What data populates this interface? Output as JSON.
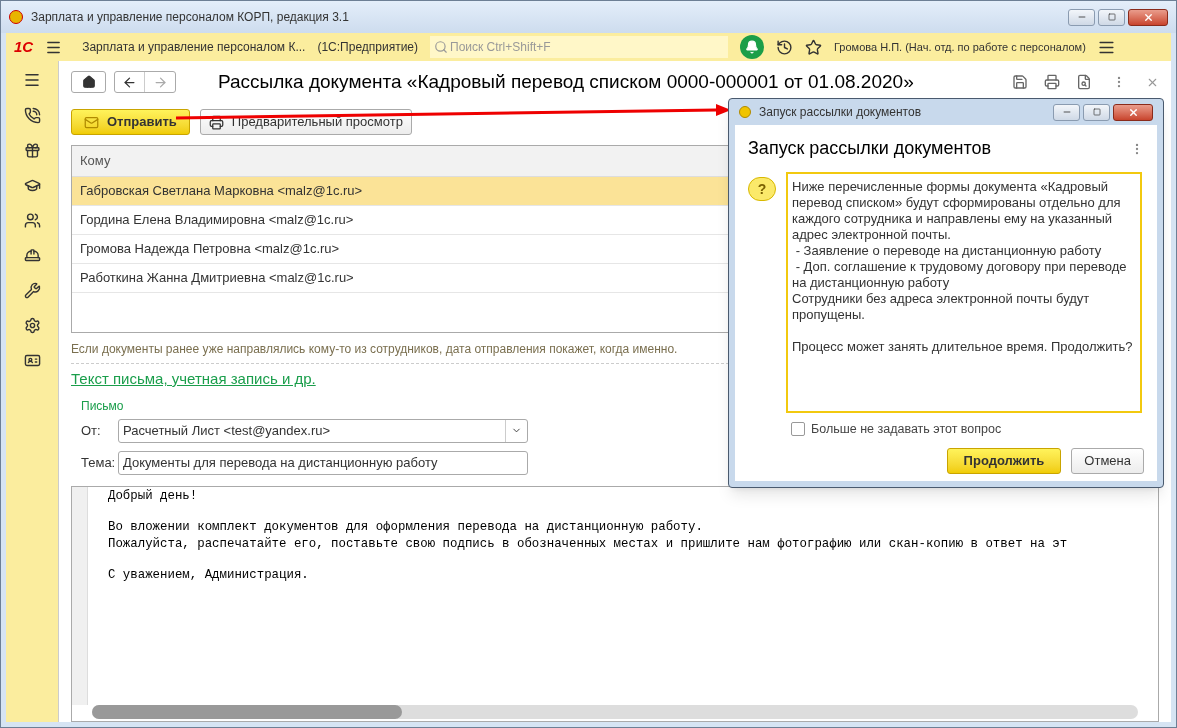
{
  "window": {
    "title": "Зарплата и управление персоналом КОРП, редакция 3.1"
  },
  "app_bar": {
    "logo": "1С",
    "app_name": "Зарплата и управление персоналом К...",
    "platform": "(1С:Предприятие)",
    "search": {
      "placeholder": "Поиск Ctrl+Shift+F"
    },
    "user": "Громова Н.П. (Нач. отд. по работе с персоналом)"
  },
  "form": {
    "title": "Рассылка документа «Кадровый перевод списком 0000-000001 от 01.08.2020»",
    "buttons": [
      {
        "kind": "primary",
        "label": "Отправить"
      },
      {
        "kind": "print",
        "label": "Предварительный просмотр"
      }
    ],
    "table": {
      "columns": [
        "Кому"
      ],
      "rows": [
        {
          "recipient": "Габровская Светлана Марковна <malz@1c.ru>",
          "selected": true
        },
        {
          "recipient": "Гордина Елена Владимировна <malz@1c.ru>",
          "selected": false
        },
        {
          "recipient": "Громова Надежда Петровна <malz@1c.ru>",
          "selected": false
        },
        {
          "recipient": "Работкина Жанна Дмитриевна <malz@1c.ru>",
          "selected": false
        }
      ]
    },
    "hint": "Если документы ранее уже направлялись кому-то из сотрудников, дата отправления покажет, когда именно.",
    "section_link": "Текст письма, учетная запись и др.",
    "group_title": "Письмо",
    "from": {
      "label": "От:",
      "value": "Расчетный Лист <test@yandex.ru>"
    },
    "subject": {
      "label": "Тема:",
      "value": "Документы для перевода на дистанционную работу"
    },
    "body": [
      {
        "lines": [
          "Добрый день!"
        ]
      },
      {
        "lines": [
          "Во вложении комплект документов для оформления перевода на дистанционную работу.",
          "Пожалуйста, распечатайте его, поставьте свою подпись в обозначенных местах и пришлите нам фотографию или скан-копию в ответ на эт"
        ]
      },
      {
        "lines": [
          "С уважением, Администрация."
        ]
      }
    ]
  },
  "dialog": {
    "window_title": "Запуск рассылки документов",
    "icon": "?",
    "heading": "Запуск рассылки документов",
    "message": [
      {
        "lines": [
          "Ниже перечисленные формы документа «Кадровый перевод списком» будут сформированы отдельно для каждого сотрудника и направлены ему на указанный адрес электронной почты.",
          " - Заявление о переводе на дистанционную работу",
          " - Доп. соглашение к трудовому договору при переводе на дистанционную работу",
          "Сотрудники без адреса электронной почты будут пропущены."
        ]
      },
      {
        "lines": [
          "Процесс может занять длительное время. Продолжить?"
        ]
      }
    ],
    "checkbox": {
      "label": "Больше не задавать этот вопрос",
      "checked": false
    },
    "buttons": [
      {
        "kind": "primary",
        "label": "Продолжить"
      },
      {
        "kind": "secondary",
        "label": "Отмена"
      }
    ]
  }
}
